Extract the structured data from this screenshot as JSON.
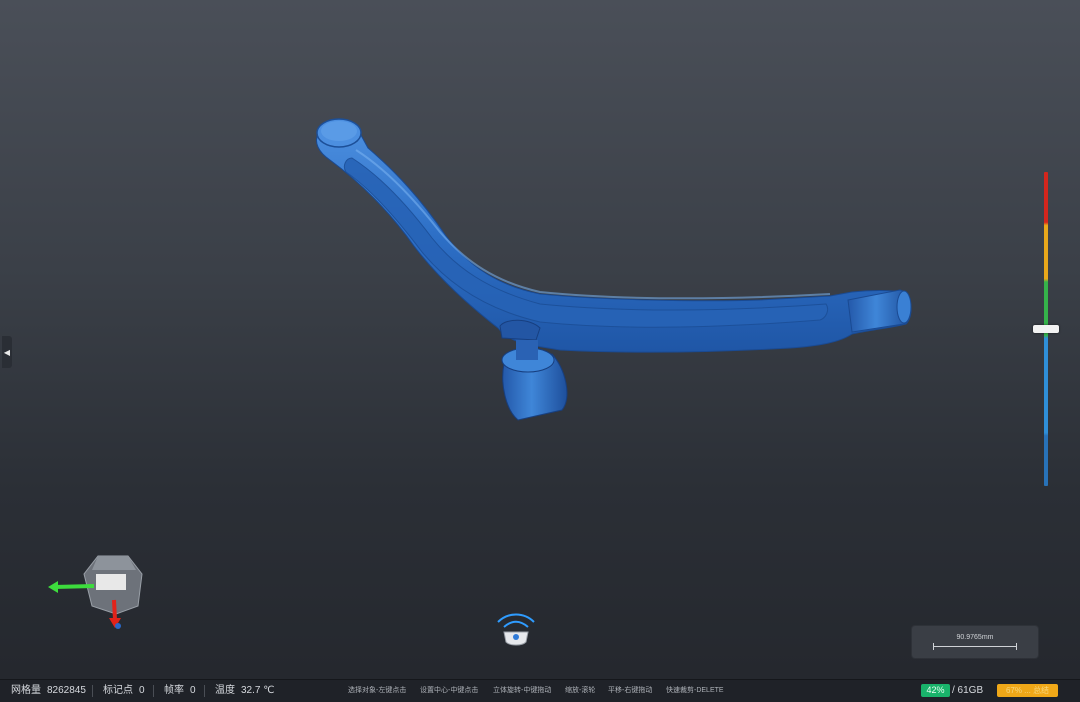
{
  "status_bar": {
    "mesh_count": {
      "label": "网格量",
      "value": "8262845"
    },
    "markers": {
      "label": "标记点",
      "value": "0"
    },
    "frame_rate": {
      "label": "帧率",
      "value": "0"
    },
    "temperature": {
      "label": "温度",
      "value": "32.7 ℃"
    },
    "hints": [
      "选择对象-左键点击",
      "设置中心-中键点击",
      "立体旋转-中键拖动",
      "缩放-滚轮",
      "平移-右键拖动",
      "快速裁剪-DELETE"
    ],
    "memory_percent": "42%",
    "memory_total": "/ 61GB",
    "warning_badge": "67% ... 总结"
  },
  "scale_bar": {
    "label": "90.9765mm"
  },
  "depth_scale": {
    "level": 0.5,
    "colors": [
      "#d4261d",
      "#e9a81b",
      "#35b34a",
      "#2f8fd8",
      "#2872b8"
    ]
  },
  "colors": {
    "model": "#2f72c8",
    "background_top": "#4a4f58",
    "background_bottom": "#24272d",
    "accent_green": "#19b36b",
    "accent_orange": "#f0a818"
  },
  "icons": {
    "collapse": "chevron-left-icon",
    "scanner": "scanner-icon",
    "axis": "axis-gizmo-icon"
  }
}
